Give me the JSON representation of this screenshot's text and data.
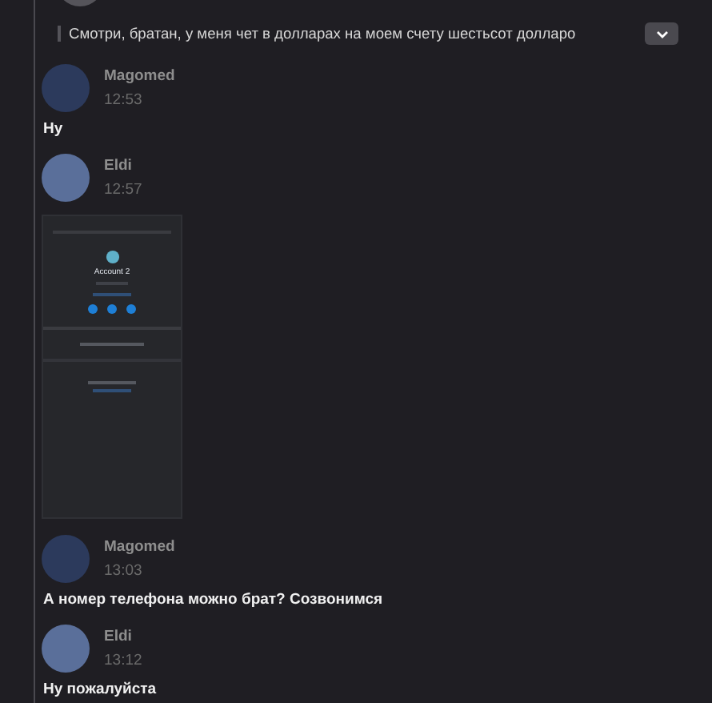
{
  "quote": {
    "text": "Смотри, братан, у меня чет в долларах на моем счету шестьсот долларо"
  },
  "messages": [
    {
      "kind": "text",
      "author": "Magomed",
      "color": "#2c3a5c",
      "time": "12:53",
      "text": "Ну"
    },
    {
      "kind": "image",
      "author": "Eldi",
      "color": "#5a6f9a",
      "time": "12:57",
      "screenshot": {
        "account": "Account 2"
      }
    },
    {
      "kind": "text",
      "author": "Magomed",
      "color": "#2c3a5c",
      "time": "13:03",
      "text": "А номер телефона можно брат? Созвонимся"
    },
    {
      "kind": "text",
      "author": "Eldi",
      "color": "#5a6f9a",
      "time": "13:12",
      "text": "Ну пожалуйста"
    }
  ]
}
